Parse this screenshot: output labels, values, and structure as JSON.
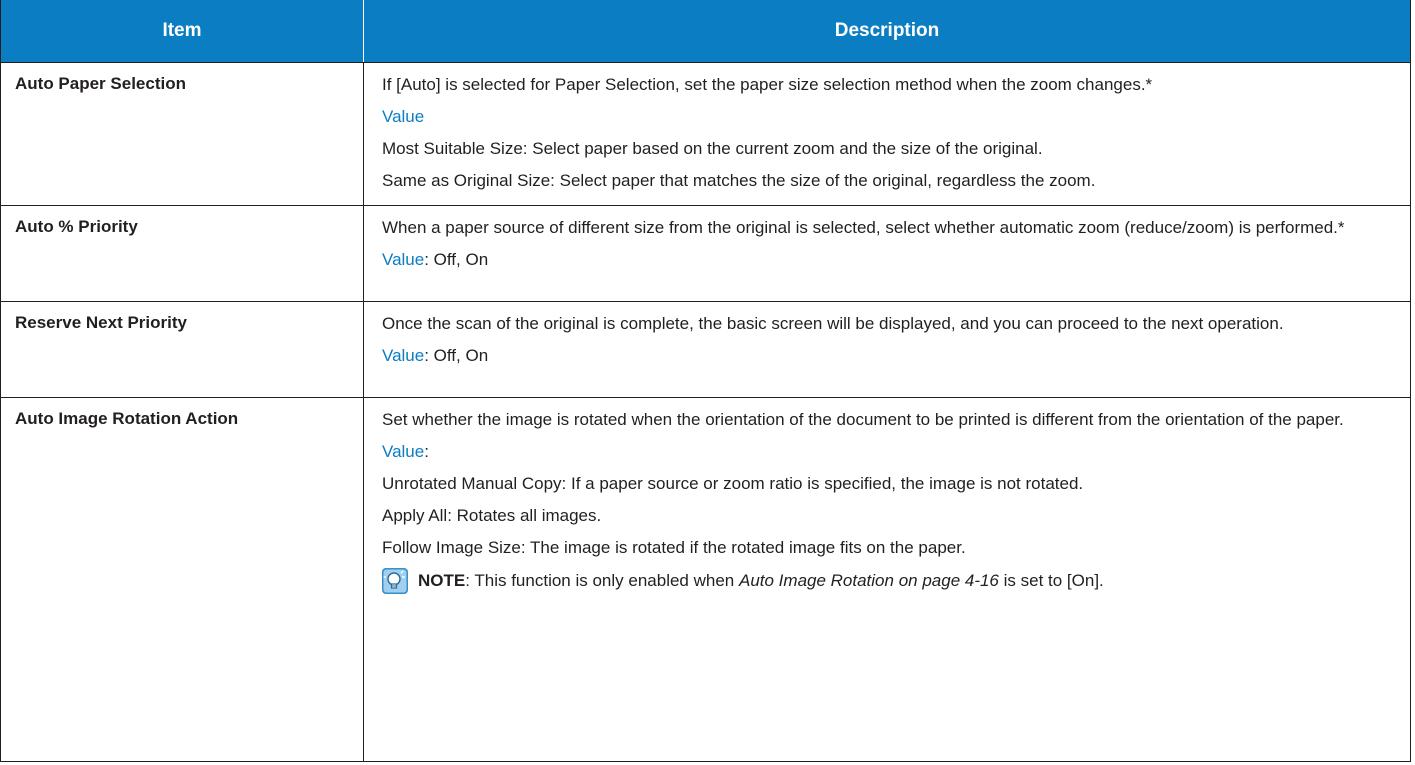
{
  "header": {
    "item": "Item",
    "description": "Description"
  },
  "rows": [
    {
      "item": "Auto Paper Selection",
      "desc": "If [Auto] is selected for Paper Selection, set the paper size selection method when the zoom changes.*",
      "value_label": "Value",
      "value_text": "",
      "options": [
        "Most Suitable Size: Select paper based on the current zoom and the size of the original.",
        "Same as Original Size: Select paper that matches the size of the original, regardless the zoom."
      ]
    },
    {
      "item": "Auto % Priority",
      "desc": "When a paper source of different size from the original is selected, select whether automatic zoom (reduce/zoom) is performed.*",
      "value_label": "Value",
      "value_text": ": Off, On"
    },
    {
      "item": "Reserve Next Priority",
      "desc": "Once the scan of the original is complete, the basic screen will be displayed, and you can proceed to the next operation.",
      "value_label": "Value",
      "value_text": ": Off, On"
    },
    {
      "item": "Auto Image Rotation Action",
      "desc": "Set whether the image is rotated when the orientation of the document to be printed is different from the orientation of the paper.",
      "value_label": "Value",
      "value_text": ":",
      "options": [
        "Unrotated Manual Copy: If a paper source or zoom ratio is specified, the image is not rotated.",
        "Apply All: Rotates all images.",
        "Follow Image Size: The image is rotated if the rotated image fits on the paper."
      ],
      "note": {
        "label": "NOTE",
        "text_before": ": This function is only enabled when ",
        "ref": "Auto Image Rotation on page 4-16",
        "text_after": " is set to [On]."
      }
    }
  ],
  "colors": {
    "header_bg": "#0b7dc3",
    "value_label": "#0b7dc3",
    "text": "#231f20"
  },
  "icons": {
    "note": "note-lightbulb-icon"
  }
}
